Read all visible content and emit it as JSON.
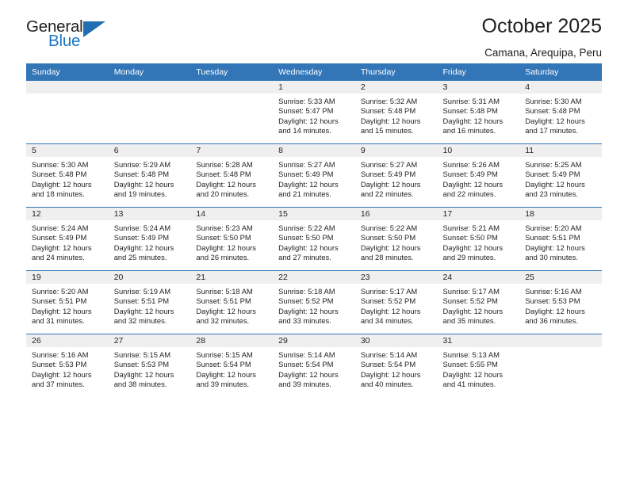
{
  "brand": {
    "name_part1": "General",
    "name_part2": "Blue",
    "accent_color": "#1f6fb2"
  },
  "header": {
    "title": "October 2025",
    "subtitle": "Camana, Arequipa, Peru"
  },
  "theme": {
    "header_row_bg": "#3276b8",
    "daynum_bg": "#efefef",
    "text_color": "#231f20"
  },
  "weekday_headers": [
    "Sunday",
    "Monday",
    "Tuesday",
    "Wednesday",
    "Thursday",
    "Friday",
    "Saturday"
  ],
  "labels": {
    "sunrise_prefix": "Sunrise:",
    "sunset_prefix": "Sunset:",
    "daylight_prefix": "Daylight:"
  },
  "weeks": [
    [
      {
        "day": "",
        "empty": true
      },
      {
        "day": "",
        "empty": true
      },
      {
        "day": "",
        "empty": true
      },
      {
        "day": "1",
        "sunrise": "Sunrise: 5:33 AM",
        "sunset": "Sunset: 5:47 PM",
        "daylight_line1": "Daylight: 12 hours",
        "daylight_line2": "and 14 minutes."
      },
      {
        "day": "2",
        "sunrise": "Sunrise: 5:32 AM",
        "sunset": "Sunset: 5:48 PM",
        "daylight_line1": "Daylight: 12 hours",
        "daylight_line2": "and 15 minutes."
      },
      {
        "day": "3",
        "sunrise": "Sunrise: 5:31 AM",
        "sunset": "Sunset: 5:48 PM",
        "daylight_line1": "Daylight: 12 hours",
        "daylight_line2": "and 16 minutes."
      },
      {
        "day": "4",
        "sunrise": "Sunrise: 5:30 AM",
        "sunset": "Sunset: 5:48 PM",
        "daylight_line1": "Daylight: 12 hours",
        "daylight_line2": "and 17 minutes."
      }
    ],
    [
      {
        "day": "5",
        "sunrise": "Sunrise: 5:30 AM",
        "sunset": "Sunset: 5:48 PM",
        "daylight_line1": "Daylight: 12 hours",
        "daylight_line2": "and 18 minutes."
      },
      {
        "day": "6",
        "sunrise": "Sunrise: 5:29 AM",
        "sunset": "Sunset: 5:48 PM",
        "daylight_line1": "Daylight: 12 hours",
        "daylight_line2": "and 19 minutes."
      },
      {
        "day": "7",
        "sunrise": "Sunrise: 5:28 AM",
        "sunset": "Sunset: 5:48 PM",
        "daylight_line1": "Daylight: 12 hours",
        "daylight_line2": "and 20 minutes."
      },
      {
        "day": "8",
        "sunrise": "Sunrise: 5:27 AM",
        "sunset": "Sunset: 5:49 PM",
        "daylight_line1": "Daylight: 12 hours",
        "daylight_line2": "and 21 minutes."
      },
      {
        "day": "9",
        "sunrise": "Sunrise: 5:27 AM",
        "sunset": "Sunset: 5:49 PM",
        "daylight_line1": "Daylight: 12 hours",
        "daylight_line2": "and 22 minutes."
      },
      {
        "day": "10",
        "sunrise": "Sunrise: 5:26 AM",
        "sunset": "Sunset: 5:49 PM",
        "daylight_line1": "Daylight: 12 hours",
        "daylight_line2": "and 22 minutes."
      },
      {
        "day": "11",
        "sunrise": "Sunrise: 5:25 AM",
        "sunset": "Sunset: 5:49 PM",
        "daylight_line1": "Daylight: 12 hours",
        "daylight_line2": "and 23 minutes."
      }
    ],
    [
      {
        "day": "12",
        "sunrise": "Sunrise: 5:24 AM",
        "sunset": "Sunset: 5:49 PM",
        "daylight_line1": "Daylight: 12 hours",
        "daylight_line2": "and 24 minutes."
      },
      {
        "day": "13",
        "sunrise": "Sunrise: 5:24 AM",
        "sunset": "Sunset: 5:49 PM",
        "daylight_line1": "Daylight: 12 hours",
        "daylight_line2": "and 25 minutes."
      },
      {
        "day": "14",
        "sunrise": "Sunrise: 5:23 AM",
        "sunset": "Sunset: 5:50 PM",
        "daylight_line1": "Daylight: 12 hours",
        "daylight_line2": "and 26 minutes."
      },
      {
        "day": "15",
        "sunrise": "Sunrise: 5:22 AM",
        "sunset": "Sunset: 5:50 PM",
        "daylight_line1": "Daylight: 12 hours",
        "daylight_line2": "and 27 minutes."
      },
      {
        "day": "16",
        "sunrise": "Sunrise: 5:22 AM",
        "sunset": "Sunset: 5:50 PM",
        "daylight_line1": "Daylight: 12 hours",
        "daylight_line2": "and 28 minutes."
      },
      {
        "day": "17",
        "sunrise": "Sunrise: 5:21 AM",
        "sunset": "Sunset: 5:50 PM",
        "daylight_line1": "Daylight: 12 hours",
        "daylight_line2": "and 29 minutes."
      },
      {
        "day": "18",
        "sunrise": "Sunrise: 5:20 AM",
        "sunset": "Sunset: 5:51 PM",
        "daylight_line1": "Daylight: 12 hours",
        "daylight_line2": "and 30 minutes."
      }
    ],
    [
      {
        "day": "19",
        "sunrise": "Sunrise: 5:20 AM",
        "sunset": "Sunset: 5:51 PM",
        "daylight_line1": "Daylight: 12 hours",
        "daylight_line2": "and 31 minutes."
      },
      {
        "day": "20",
        "sunrise": "Sunrise: 5:19 AM",
        "sunset": "Sunset: 5:51 PM",
        "daylight_line1": "Daylight: 12 hours",
        "daylight_line2": "and 32 minutes."
      },
      {
        "day": "21",
        "sunrise": "Sunrise: 5:18 AM",
        "sunset": "Sunset: 5:51 PM",
        "daylight_line1": "Daylight: 12 hours",
        "daylight_line2": "and 32 minutes."
      },
      {
        "day": "22",
        "sunrise": "Sunrise: 5:18 AM",
        "sunset": "Sunset: 5:52 PM",
        "daylight_line1": "Daylight: 12 hours",
        "daylight_line2": "and 33 minutes."
      },
      {
        "day": "23",
        "sunrise": "Sunrise: 5:17 AM",
        "sunset": "Sunset: 5:52 PM",
        "daylight_line1": "Daylight: 12 hours",
        "daylight_line2": "and 34 minutes."
      },
      {
        "day": "24",
        "sunrise": "Sunrise: 5:17 AM",
        "sunset": "Sunset: 5:52 PM",
        "daylight_line1": "Daylight: 12 hours",
        "daylight_line2": "and 35 minutes."
      },
      {
        "day": "25",
        "sunrise": "Sunrise: 5:16 AM",
        "sunset": "Sunset: 5:53 PM",
        "daylight_line1": "Daylight: 12 hours",
        "daylight_line2": "and 36 minutes."
      }
    ],
    [
      {
        "day": "26",
        "sunrise": "Sunrise: 5:16 AM",
        "sunset": "Sunset: 5:53 PM",
        "daylight_line1": "Daylight: 12 hours",
        "daylight_line2": "and 37 minutes."
      },
      {
        "day": "27",
        "sunrise": "Sunrise: 5:15 AM",
        "sunset": "Sunset: 5:53 PM",
        "daylight_line1": "Daylight: 12 hours",
        "daylight_line2": "and 38 minutes."
      },
      {
        "day": "28",
        "sunrise": "Sunrise: 5:15 AM",
        "sunset": "Sunset: 5:54 PM",
        "daylight_line1": "Daylight: 12 hours",
        "daylight_line2": "and 39 minutes."
      },
      {
        "day": "29",
        "sunrise": "Sunrise: 5:14 AM",
        "sunset": "Sunset: 5:54 PM",
        "daylight_line1": "Daylight: 12 hours",
        "daylight_line2": "and 39 minutes."
      },
      {
        "day": "30",
        "sunrise": "Sunrise: 5:14 AM",
        "sunset": "Sunset: 5:54 PM",
        "daylight_line1": "Daylight: 12 hours",
        "daylight_line2": "and 40 minutes."
      },
      {
        "day": "31",
        "sunrise": "Sunrise: 5:13 AM",
        "sunset": "Sunset: 5:55 PM",
        "daylight_line1": "Daylight: 12 hours",
        "daylight_line2": "and 41 minutes."
      },
      {
        "day": "",
        "empty": true
      }
    ]
  ]
}
